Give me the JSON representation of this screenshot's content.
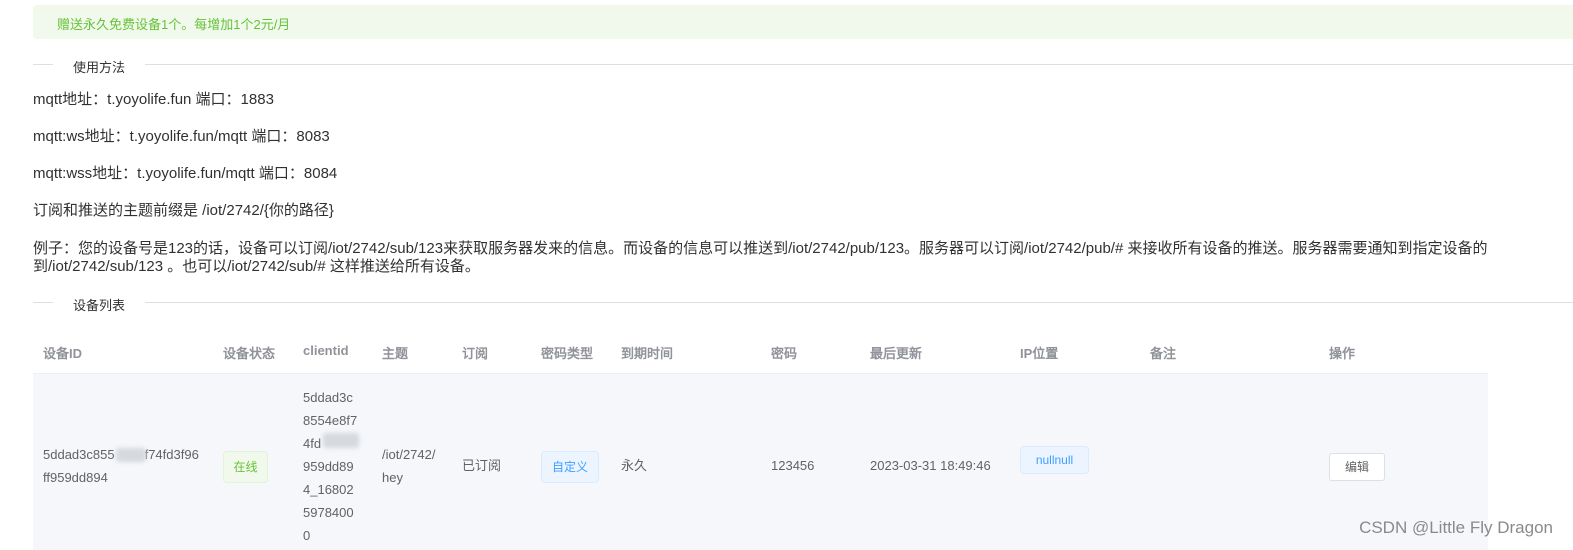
{
  "notice": "赠送永久免费设备1个。每增加1个2元/月",
  "usage_title": "使用方法",
  "usage": {
    "mqtt": "mqtt地址：t.yoyolife.fun 端口：1883",
    "ws": "mqtt:ws地址：t.yoyolife.fun/mqtt 端口：8083",
    "wss": "mqtt:wss地址：t.yoyolife.fun/mqtt 端口：8084",
    "prefix": "订阅和推送的主题前缀是 /iot/2742/{你的路径}",
    "example_line1": "例子：您的设备号是123的话，设备可以订阅/iot/2742/sub/123来获取服务器发来的信息。而设备的信息可以推送到/iot/2742/pub/123。服务器可以订阅/iot/2742/pub/# 来接收所有设备的推送。服务器需要通知到指定设备的",
    "example_line2": "到/iot/2742/sub/123 。也可以/iot/2742/sub/# 这样推送给所有设备。"
  },
  "device_list_title": "设备列表",
  "table": {
    "headers": {
      "device_id": "设备ID",
      "status": "设备状态",
      "clientid": "clientid",
      "topic": "主题",
      "subscribe": "订阅",
      "pwd_type": "密码类型",
      "expire": "到期时间",
      "password": "密码",
      "last_update": "最后更新",
      "ip": "IP位置",
      "remark": "备注",
      "action": "操作"
    },
    "row": {
      "device_id_line1": "5ddad3c855",
      "device_id_line1b": "f74fd3f96",
      "device_id_line2": "ff959dd894",
      "status": "在线",
      "clientid_lines": [
        "5ddad3c",
        "8554e8f7",
        "4fd",
        "959dd89",
        "4_16802",
        "5978400",
        "0"
      ],
      "topic_line1": "/iot/2742/",
      "topic_line2": "hey",
      "subscribe": "已订阅",
      "pwd_type": "自定义",
      "expire": "永久",
      "password": "123456",
      "last_update": "2023-03-31 18:49:46",
      "ip": "nullnull",
      "remark": "",
      "edit_label": "编辑"
    }
  },
  "watermark": "CSDN @Little Fly Dragon"
}
